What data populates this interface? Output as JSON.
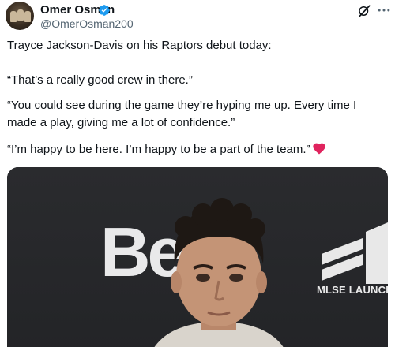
{
  "user": {
    "display_name": "Omer Osman",
    "handle": "@OmerOsman200"
  },
  "icons": {
    "verified": "verified-badge-icon",
    "grok": "grok-icon",
    "more": "more-options-icon",
    "heart": "red-heart-icon"
  },
  "colors": {
    "verified_blue": "#1d9bf0",
    "heart_red": "#e0245e",
    "handle_gray": "#536471"
  },
  "tweet": {
    "p1": "Trayce Jackson-Davis on his Raptors debut today:",
    "p2": "“That’s a really good crew in there.”",
    "p3": "“You could see during the game they’re hyping me up. Every time I made a play, giving me a lot of confidence.”",
    "p4": "“I’m happy to be here. I’m happy to be a part of the team.”"
  },
  "media": {
    "backdrop_letters": "Be",
    "sponsor_text": "MLSE LAUNCHPAD"
  }
}
